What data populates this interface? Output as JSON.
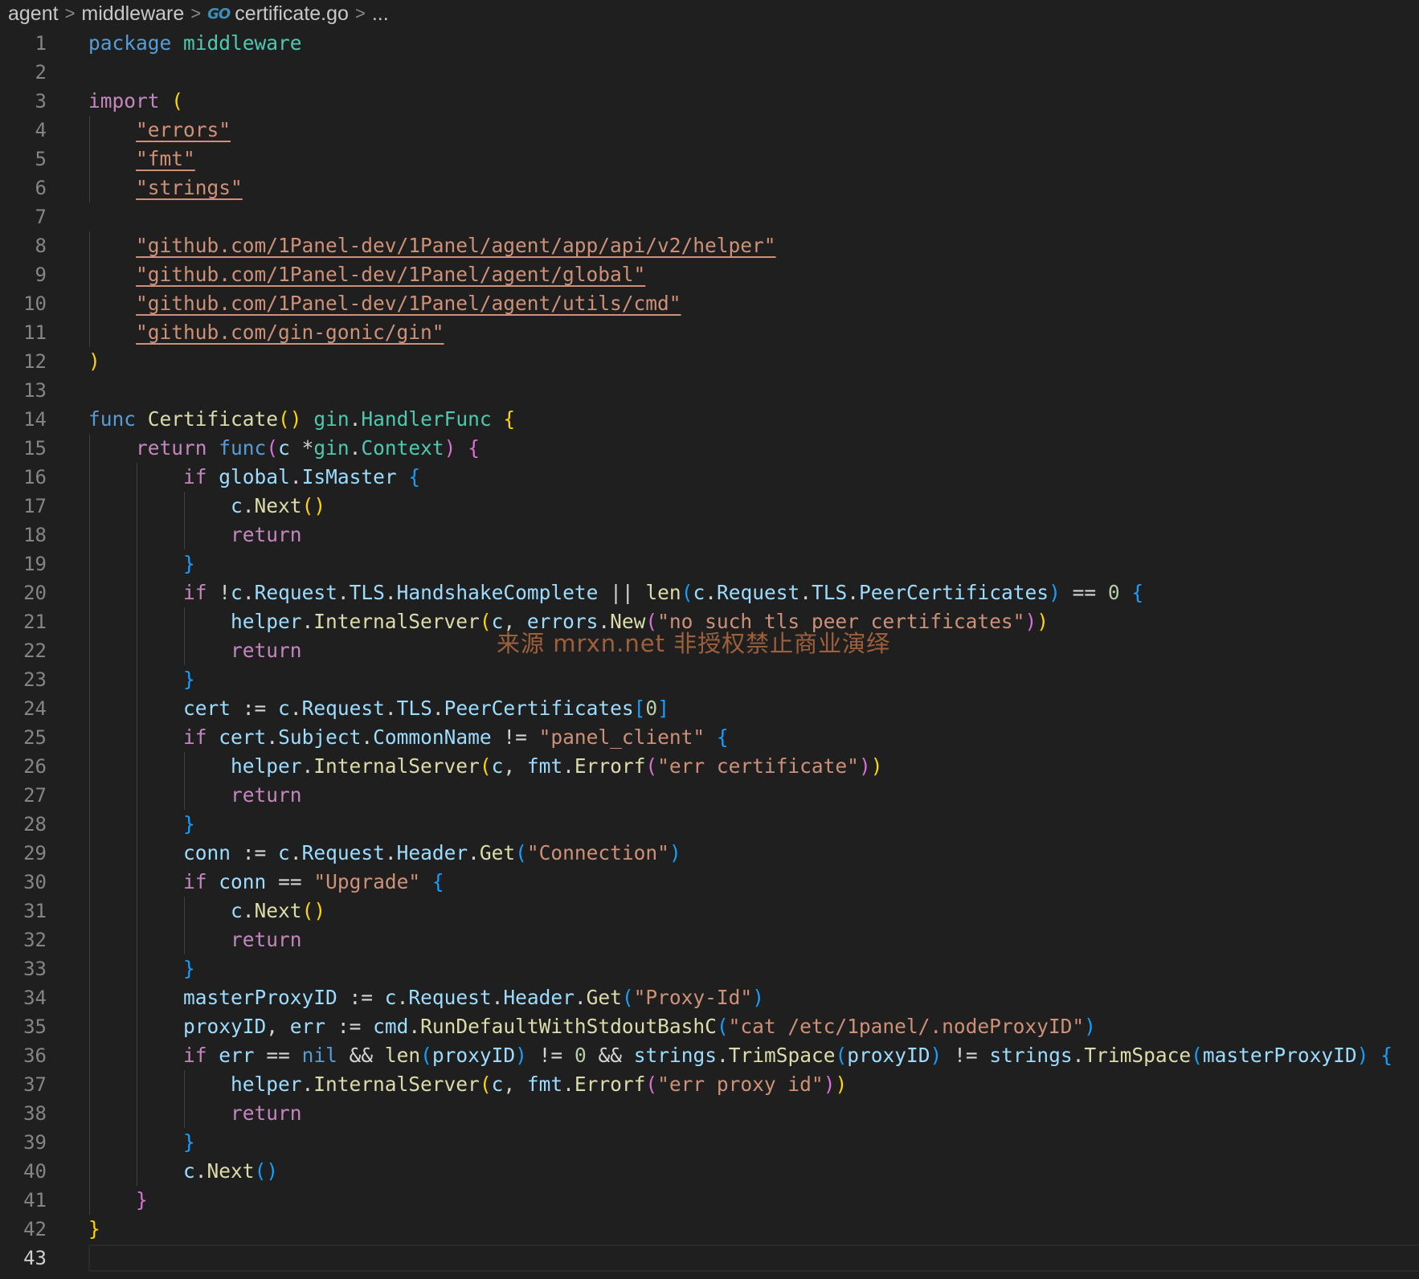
{
  "breadcrumb": {
    "items": [
      "agent",
      "middleware",
      "certificate.go",
      "..."
    ],
    "separator": ">",
    "file_icon": "go-file-icon",
    "file_icon_text": "GO"
  },
  "editor": {
    "language": "go",
    "current_line": 43,
    "lines": [
      [
        [
          "kw",
          "package"
        ],
        [
          "op",
          " "
        ],
        [
          "pkg",
          "middleware"
        ]
      ],
      [],
      [
        [
          "ctl",
          "import"
        ],
        [
          "op",
          " "
        ],
        [
          "b1",
          "("
        ]
      ],
      [
        [
          "op",
          "    "
        ],
        [
          "imp",
          "\"errors\""
        ]
      ],
      [
        [
          "op",
          "    "
        ],
        [
          "imp",
          "\"fmt\""
        ]
      ],
      [
        [
          "op",
          "    "
        ],
        [
          "imp",
          "\"strings\""
        ]
      ],
      [],
      [
        [
          "op",
          "    "
        ],
        [
          "imp",
          "\"github.com/1Panel-dev/1Panel/agent/app/api/v2/helper\""
        ]
      ],
      [
        [
          "op",
          "    "
        ],
        [
          "imp",
          "\"github.com/1Panel-dev/1Panel/agent/global\""
        ]
      ],
      [
        [
          "op",
          "    "
        ],
        [
          "imp",
          "\"github.com/1Panel-dev/1Panel/agent/utils/cmd\""
        ]
      ],
      [
        [
          "op",
          "    "
        ],
        [
          "imp",
          "\"github.com/gin-gonic/gin\""
        ]
      ],
      [
        [
          "b1",
          ")"
        ]
      ],
      [],
      [
        [
          "kw",
          "func"
        ],
        [
          "op",
          " "
        ],
        [
          "fn",
          "Certificate"
        ],
        [
          "b1",
          "()"
        ],
        [
          "op",
          " "
        ],
        [
          "pkg",
          "gin"
        ],
        [
          "op",
          "."
        ],
        [
          "type",
          "HandlerFunc"
        ],
        [
          "op",
          " "
        ],
        [
          "b1",
          "{"
        ]
      ],
      [
        [
          "op",
          "    "
        ],
        [
          "ctl",
          "return"
        ],
        [
          "op",
          " "
        ],
        [
          "kw",
          "func"
        ],
        [
          "b2",
          "("
        ],
        [
          "var",
          "c"
        ],
        [
          "op",
          " *"
        ],
        [
          "pkg",
          "gin"
        ],
        [
          "op",
          "."
        ],
        [
          "type",
          "Context"
        ],
        [
          "b2",
          ")"
        ],
        [
          "op",
          " "
        ],
        [
          "b2",
          "{"
        ]
      ],
      [
        [
          "op",
          "        "
        ],
        [
          "ctl",
          "if"
        ],
        [
          "op",
          " "
        ],
        [
          "var",
          "global"
        ],
        [
          "op",
          "."
        ],
        [
          "var",
          "IsMaster"
        ],
        [
          "op",
          " "
        ],
        [
          "b3",
          "{"
        ]
      ],
      [
        [
          "op",
          "            "
        ],
        [
          "var",
          "c"
        ],
        [
          "op",
          "."
        ],
        [
          "fn",
          "Next"
        ],
        [
          "b1",
          "()"
        ]
      ],
      [
        [
          "op",
          "            "
        ],
        [
          "ctl",
          "return"
        ]
      ],
      [
        [
          "op",
          "        "
        ],
        [
          "b3",
          "}"
        ]
      ],
      [
        [
          "op",
          "        "
        ],
        [
          "ctl",
          "if"
        ],
        [
          "op",
          " !"
        ],
        [
          "var",
          "c"
        ],
        [
          "op",
          "."
        ],
        [
          "var",
          "Request"
        ],
        [
          "op",
          "."
        ],
        [
          "var",
          "TLS"
        ],
        [
          "op",
          "."
        ],
        [
          "var",
          "HandshakeComplete"
        ],
        [
          "op",
          " || "
        ],
        [
          "fn",
          "len"
        ],
        [
          "b3",
          "("
        ],
        [
          "var",
          "c"
        ],
        [
          "op",
          "."
        ],
        [
          "var",
          "Request"
        ],
        [
          "op",
          "."
        ],
        [
          "var",
          "TLS"
        ],
        [
          "op",
          "."
        ],
        [
          "var",
          "PeerCertificates"
        ],
        [
          "b3",
          ")"
        ],
        [
          "op",
          " == "
        ],
        [
          "num",
          "0"
        ],
        [
          "op",
          " "
        ],
        [
          "b3",
          "{"
        ]
      ],
      [
        [
          "op",
          "            "
        ],
        [
          "var",
          "helper"
        ],
        [
          "op",
          "."
        ],
        [
          "fn",
          "InternalServer"
        ],
        [
          "b1",
          "("
        ],
        [
          "var",
          "c"
        ],
        [
          "op",
          ", "
        ],
        [
          "var",
          "errors"
        ],
        [
          "op",
          "."
        ],
        [
          "fn",
          "New"
        ],
        [
          "b2",
          "("
        ],
        [
          "str",
          "\"no such tls peer certificates\""
        ],
        [
          "b2",
          ")"
        ],
        [
          "b1",
          ")"
        ]
      ],
      [
        [
          "op",
          "            "
        ],
        [
          "ctl",
          "return"
        ]
      ],
      [
        [
          "op",
          "        "
        ],
        [
          "b3",
          "}"
        ]
      ],
      [
        [
          "op",
          "        "
        ],
        [
          "var",
          "cert"
        ],
        [
          "op",
          " := "
        ],
        [
          "var",
          "c"
        ],
        [
          "op",
          "."
        ],
        [
          "var",
          "Request"
        ],
        [
          "op",
          "."
        ],
        [
          "var",
          "TLS"
        ],
        [
          "op",
          "."
        ],
        [
          "var",
          "PeerCertificates"
        ],
        [
          "b3",
          "["
        ],
        [
          "num",
          "0"
        ],
        [
          "b3",
          "]"
        ]
      ],
      [
        [
          "op",
          "        "
        ],
        [
          "ctl",
          "if"
        ],
        [
          "op",
          " "
        ],
        [
          "var",
          "cert"
        ],
        [
          "op",
          "."
        ],
        [
          "var",
          "Subject"
        ],
        [
          "op",
          "."
        ],
        [
          "var",
          "CommonName"
        ],
        [
          "op",
          " != "
        ],
        [
          "str",
          "\"panel_client\""
        ],
        [
          "op",
          " "
        ],
        [
          "b3",
          "{"
        ]
      ],
      [
        [
          "op",
          "            "
        ],
        [
          "var",
          "helper"
        ],
        [
          "op",
          "."
        ],
        [
          "fn",
          "InternalServer"
        ],
        [
          "b1",
          "("
        ],
        [
          "var",
          "c"
        ],
        [
          "op",
          ", "
        ],
        [
          "var",
          "fmt"
        ],
        [
          "op",
          "."
        ],
        [
          "fn",
          "Errorf"
        ],
        [
          "b2",
          "("
        ],
        [
          "str",
          "\"err certificate\""
        ],
        [
          "b2",
          ")"
        ],
        [
          "b1",
          ")"
        ]
      ],
      [
        [
          "op",
          "            "
        ],
        [
          "ctl",
          "return"
        ]
      ],
      [
        [
          "op",
          "        "
        ],
        [
          "b3",
          "}"
        ]
      ],
      [
        [
          "op",
          "        "
        ],
        [
          "var",
          "conn"
        ],
        [
          "op",
          " := "
        ],
        [
          "var",
          "c"
        ],
        [
          "op",
          "."
        ],
        [
          "var",
          "Request"
        ],
        [
          "op",
          "."
        ],
        [
          "var",
          "Header"
        ],
        [
          "op",
          "."
        ],
        [
          "fn",
          "Get"
        ],
        [
          "b3",
          "("
        ],
        [
          "str",
          "\"Connection\""
        ],
        [
          "b3",
          ")"
        ]
      ],
      [
        [
          "op",
          "        "
        ],
        [
          "ctl",
          "if"
        ],
        [
          "op",
          " "
        ],
        [
          "var",
          "conn"
        ],
        [
          "op",
          " == "
        ],
        [
          "str",
          "\"Upgrade\""
        ],
        [
          "op",
          " "
        ],
        [
          "b3",
          "{"
        ]
      ],
      [
        [
          "op",
          "            "
        ],
        [
          "var",
          "c"
        ],
        [
          "op",
          "."
        ],
        [
          "fn",
          "Next"
        ],
        [
          "b1",
          "()"
        ]
      ],
      [
        [
          "op",
          "            "
        ],
        [
          "ctl",
          "return"
        ]
      ],
      [
        [
          "op",
          "        "
        ],
        [
          "b3",
          "}"
        ]
      ],
      [
        [
          "op",
          "        "
        ],
        [
          "var",
          "masterProxyID"
        ],
        [
          "op",
          " := "
        ],
        [
          "var",
          "c"
        ],
        [
          "op",
          "."
        ],
        [
          "var",
          "Request"
        ],
        [
          "op",
          "."
        ],
        [
          "var",
          "Header"
        ],
        [
          "op",
          "."
        ],
        [
          "fn",
          "Get"
        ],
        [
          "b3",
          "("
        ],
        [
          "str",
          "\"Proxy-Id\""
        ],
        [
          "b3",
          ")"
        ]
      ],
      [
        [
          "op",
          "        "
        ],
        [
          "var",
          "proxyID"
        ],
        [
          "op",
          ", "
        ],
        [
          "var",
          "err"
        ],
        [
          "op",
          " := "
        ],
        [
          "var",
          "cmd"
        ],
        [
          "op",
          "."
        ],
        [
          "fn",
          "RunDefaultWithStdoutBashC"
        ],
        [
          "b3",
          "("
        ],
        [
          "str",
          "\"cat /etc/1panel/.nodeProxyID\""
        ],
        [
          "b3",
          ")"
        ]
      ],
      [
        [
          "op",
          "        "
        ],
        [
          "ctl",
          "if"
        ],
        [
          "op",
          " "
        ],
        [
          "var",
          "err"
        ],
        [
          "op",
          " == "
        ],
        [
          "kw",
          "nil"
        ],
        [
          "op",
          " && "
        ],
        [
          "fn",
          "len"
        ],
        [
          "b3",
          "("
        ],
        [
          "var",
          "proxyID"
        ],
        [
          "b3",
          ")"
        ],
        [
          "op",
          " != "
        ],
        [
          "num",
          "0"
        ],
        [
          "op",
          " && "
        ],
        [
          "var",
          "strings"
        ],
        [
          "op",
          "."
        ],
        [
          "fn",
          "TrimSpace"
        ],
        [
          "b3",
          "("
        ],
        [
          "var",
          "proxyID"
        ],
        [
          "b3",
          ")"
        ],
        [
          "op",
          " != "
        ],
        [
          "var",
          "strings"
        ],
        [
          "op",
          "."
        ],
        [
          "fn",
          "TrimSpace"
        ],
        [
          "b3",
          "("
        ],
        [
          "var",
          "masterProxyID"
        ],
        [
          "b3",
          ")"
        ],
        [
          "op",
          " "
        ],
        [
          "b3",
          "{"
        ]
      ],
      [
        [
          "op",
          "            "
        ],
        [
          "var",
          "helper"
        ],
        [
          "op",
          "."
        ],
        [
          "fn",
          "InternalServer"
        ],
        [
          "b1",
          "("
        ],
        [
          "var",
          "c"
        ],
        [
          "op",
          ", "
        ],
        [
          "var",
          "fmt"
        ],
        [
          "op",
          "."
        ],
        [
          "fn",
          "Errorf"
        ],
        [
          "b2",
          "("
        ],
        [
          "str",
          "\"err proxy id\""
        ],
        [
          "b2",
          ")"
        ],
        [
          "b1",
          ")"
        ]
      ],
      [
        [
          "op",
          "            "
        ],
        [
          "ctl",
          "return"
        ]
      ],
      [
        [
          "op",
          "        "
        ],
        [
          "b3",
          "}"
        ]
      ],
      [
        [
          "op",
          "        "
        ],
        [
          "var",
          "c"
        ],
        [
          "op",
          "."
        ],
        [
          "fn",
          "Next"
        ],
        [
          "b3",
          "()"
        ]
      ],
      [
        [
          "op",
          "    "
        ],
        [
          "b2",
          "}"
        ]
      ],
      [
        [
          "b1",
          "}"
        ]
      ],
      []
    ]
  },
  "watermark": "来源 mrxn.net 非授权禁止商业演绎",
  "colors": {
    "background": "#1f1f1f",
    "keyword": "#569cd6",
    "control": "#c586c0",
    "function": "#dcdcaa",
    "type": "#4ec9b0",
    "variable": "#9cdcfe",
    "string": "#ce9178",
    "number": "#b5cea8",
    "bracket_level1": "#ffd700",
    "bracket_level2": "#da70d6",
    "bracket_level3": "#179fff"
  }
}
